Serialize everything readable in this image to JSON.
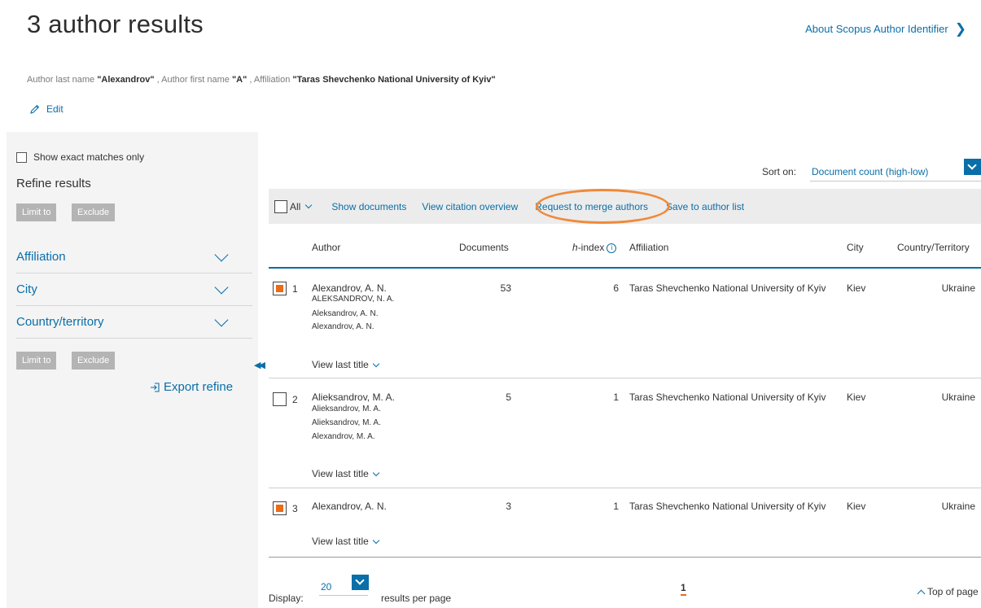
{
  "page": {
    "title": "3 author results",
    "about_link": "About Scopus Author Identifier",
    "query": {
      "last_name_label": "Author last name",
      "last_name_value": "\"Alexandrov\"",
      "first_name_label": ", Author first name",
      "first_name_value": "\"A\"",
      "affiliation_label": ", Affiliation",
      "affiliation_value": "\"Taras Shevchenko National University of Kyiv\""
    },
    "edit_label": "Edit"
  },
  "sidebar": {
    "exact_matches_label": "Show exact matches only",
    "refine_title": "Refine results",
    "limit_to": "Limit to",
    "exclude": "Exclude",
    "facets": [
      "Affiliation",
      "City",
      "Country/territory"
    ],
    "export_refine": "Export refine"
  },
  "sort": {
    "label": "Sort on:",
    "value": "Document count (high-low)"
  },
  "toolbar": {
    "all": "All",
    "show_documents": "Show documents",
    "view_citation_overview": "View citation overview",
    "request_merge": "Request to merge authors",
    "save_to_list": "Save to author list"
  },
  "table": {
    "headers": {
      "author": "Author",
      "documents": "Documents",
      "h_prefix": "h",
      "h_index": "-index",
      "affiliation": "Affiliation",
      "city": "City",
      "country": "Country/Territory"
    },
    "view_last_title": "View last title",
    "rows": [
      {
        "num": "1",
        "checked": true,
        "author": "Alexandrov, A. N.",
        "variants": [
          "ALEKSANDROV, N. A.",
          "Aleksandrov, A. N.",
          "Alexandrov, A. N."
        ],
        "documents": "53",
        "h_index": "6",
        "affiliation": "Taras Shevchenko National University of Kyiv",
        "city": "Kiev",
        "country": "Ukraine"
      },
      {
        "num": "2",
        "checked": false,
        "author": "Alieksandrov, M. A.",
        "variants": [
          "Alieksandrov, M. A.",
          "Alieksandrov, M. A.",
          "Alexandrov, M. A."
        ],
        "documents": "5",
        "h_index": "1",
        "affiliation": "Taras Shevchenko National University of Kyiv",
        "city": "Kiev",
        "country": "Ukraine"
      },
      {
        "num": "3",
        "checked": true,
        "author": "Alexandrov, A. N.",
        "variants": [],
        "documents": "3",
        "h_index": "1",
        "affiliation": "Taras Shevchenko National University of Kyiv",
        "city": "Kiev",
        "country": "Ukraine"
      }
    ]
  },
  "footer": {
    "display_label": "Display:",
    "per_page_value": "20",
    "results_per_page": "results per page",
    "page_number": "1",
    "top_of_page": "Top of page"
  },
  "colors": {
    "link": "#0a6ea8",
    "accent_orange": "#ea6b18",
    "sidebar_bg": "#f4f4f4",
    "toolbar_bg": "#ececec"
  }
}
